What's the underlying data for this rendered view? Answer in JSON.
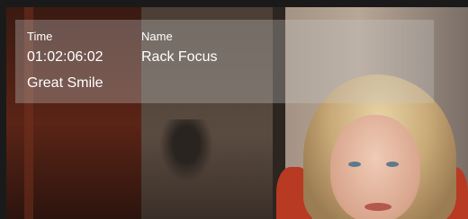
{
  "marker_overlay": {
    "time_label": "Time",
    "time_value": "01:02:06:02",
    "name_label": "Name",
    "name_value": "Rack Focus",
    "note_value": "Great Smile"
  },
  "colors": {
    "overlay_bg": "#c8c8c8",
    "text": "#ffffff",
    "frame_border": "#1a1a1a"
  }
}
